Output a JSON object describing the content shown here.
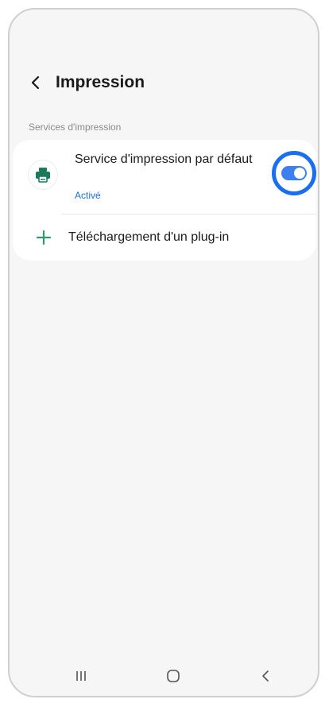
{
  "header": {
    "title": "Impression",
    "back_icon": "chevron-left-icon"
  },
  "section": {
    "label": "Services d'impression"
  },
  "print_service": {
    "title": "Service d'impression par défaut",
    "status": "Activé",
    "enabled": true,
    "icon": "printer-icon",
    "icon_color": "#1a7a5a"
  },
  "plugin": {
    "label": "Téléchargement d'un plug-in",
    "icon": "plus-icon",
    "icon_color": "#2e9b6a"
  },
  "navbar": {
    "items": [
      "recent-apps-icon",
      "home-icon",
      "back-icon"
    ]
  },
  "colors": {
    "accent": "#1a6ff0",
    "toggle_on": "#3e7ff0",
    "status_text": "#1e6fd9"
  }
}
